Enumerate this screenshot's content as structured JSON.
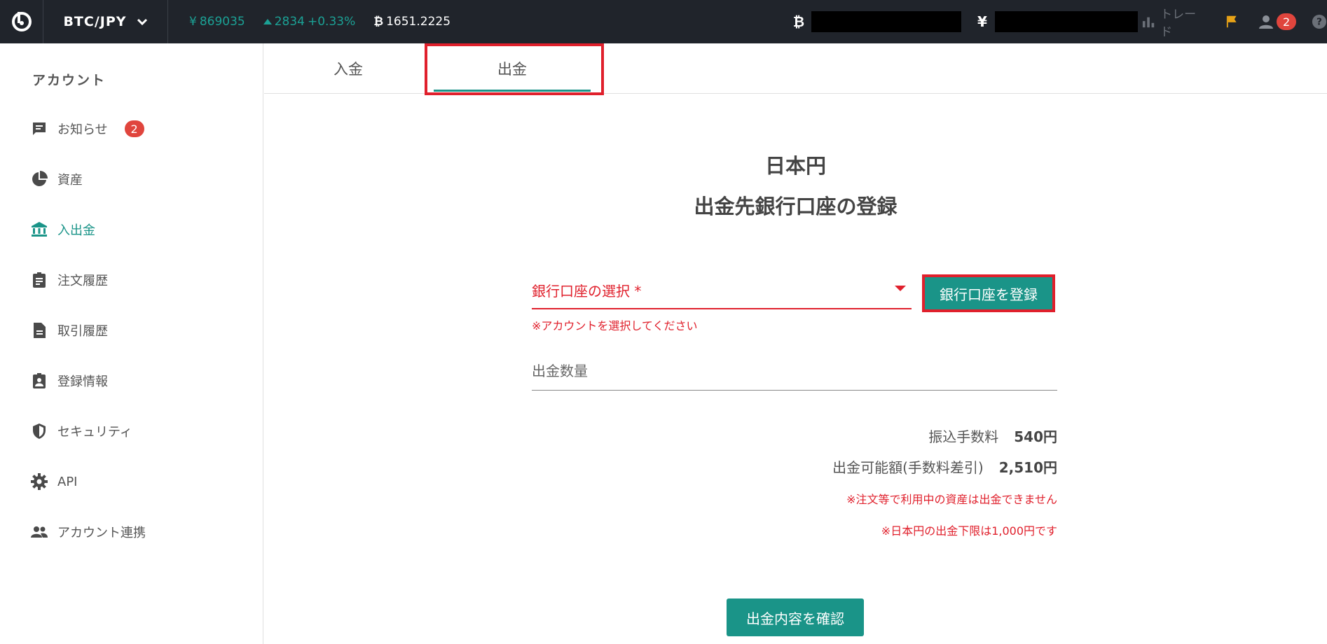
{
  "header": {
    "pair": "BTC/JPY",
    "price_symbol": "¥",
    "price": "869035",
    "change": "2834",
    "change_pct": "+0.33%",
    "volume_symbol": "₿",
    "volume": "1651.2225",
    "btc_symbol": "₿",
    "jpy_symbol": "¥",
    "trade_label": "トレード",
    "notification_count": "2"
  },
  "sidebar": {
    "title": "アカウント",
    "items": [
      {
        "label": "お知らせ",
        "badge": "2"
      },
      {
        "label": "資産"
      },
      {
        "label": "入出金"
      },
      {
        "label": "注文履歴"
      },
      {
        "label": "取引履歴"
      },
      {
        "label": "登録情報"
      },
      {
        "label": "セキュリティ"
      },
      {
        "label": "API"
      },
      {
        "label": "アカウント連携"
      }
    ]
  },
  "tabs": {
    "deposit": "入金",
    "withdraw": "出金"
  },
  "main": {
    "title_line1": "日本円",
    "title_line2": "出金先銀行口座の登録",
    "bank_select_label": "銀行口座の選択 *",
    "bank_select_error": "※アカウントを選択してください",
    "register_button": "銀行口座を登録",
    "amount_placeholder": "出金数量",
    "fee_label": "振込手数料",
    "fee_value": "540円",
    "available_label": "出金可能額(手数料差引)",
    "available_value": "2,510円",
    "note1": "※注文等で利用中の資産は出金できません",
    "note2": "※日本円の出金下限は1,000円です",
    "confirm_button": "出金内容を確認"
  },
  "colors": {
    "accent": "#1a9488",
    "topbar": "#20242b",
    "error": "#e0202c",
    "highlight": "#e0202c"
  }
}
